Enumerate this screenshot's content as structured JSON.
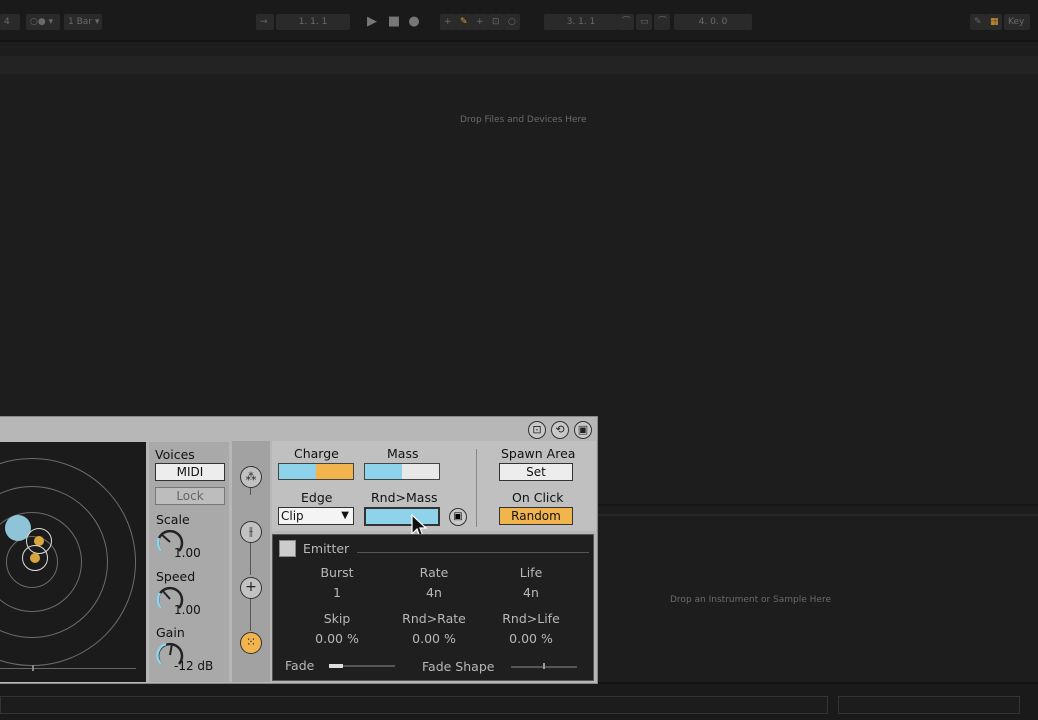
{
  "transport": {
    "meter_left": "4",
    "quantize": "1 Bar",
    "position": "1.  1.  1",
    "loop_start": "3.  1.  1",
    "loop_length": "4.  0.  0",
    "key_label": "Key"
  },
  "workspace": {
    "drop_files": "Drop Files and Devices Here",
    "drop_instrument": "Drop an Instrument or Sample Here"
  },
  "device": {
    "voices_label": "Voices",
    "midi_button": "MIDI",
    "lock_button": "Lock",
    "scale_label": "Scale",
    "scale_value": "1.00",
    "speed_label": "Speed",
    "speed_value": "1.00",
    "gain_label": "Gain",
    "gain_value": "-12 dB",
    "charge_label": "Charge",
    "mass_label": "Mass",
    "edge_label": "Edge",
    "edge_value": "Clip",
    "rnd_mass_label": "Rnd>Mass",
    "spawn_area_label": "Spawn Area",
    "set_button": "Set",
    "on_click_label": "On Click",
    "random_button": "Random",
    "charge_level": 0.5,
    "mass_level": 0.5,
    "rnd_mass_level": 1.0
  },
  "emitter": {
    "title": "Emitter",
    "burst_label": "Burst",
    "burst_value": "1",
    "rate_label": "Rate",
    "rate_value": "4n",
    "life_label": "Life",
    "life_value": "4n",
    "skip_label": "Skip",
    "skip_value": "0.00 %",
    "rnd_rate_label": "Rnd>Rate",
    "rnd_rate_value": "0.00 %",
    "rnd_life_label": "Rnd>Life",
    "rnd_life_value": "0.00 %",
    "fade_label": "Fade",
    "fade_shape_label": "Fade Shape"
  },
  "colors": {
    "accent_blue": "#8fd3ea",
    "accent_orange": "#f2b44c",
    "panel": "#b7b7b7",
    "background": "#1d1d1d"
  }
}
